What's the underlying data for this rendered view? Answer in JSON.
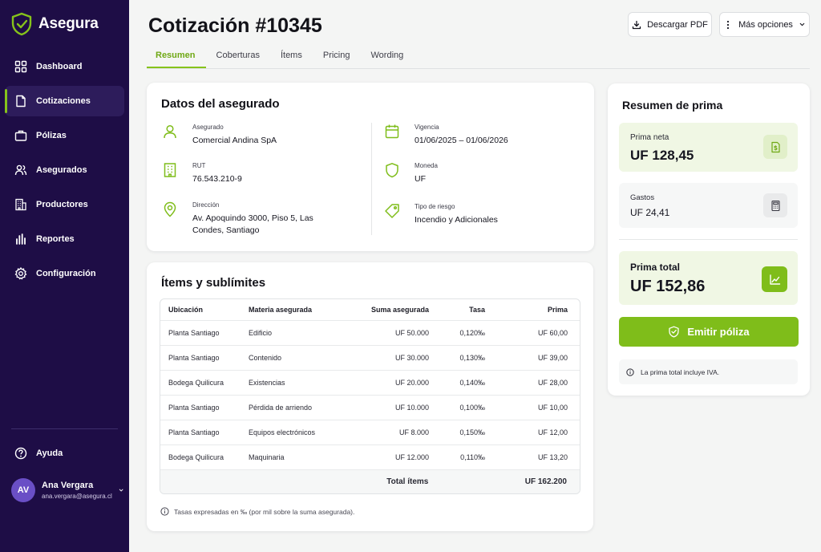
{
  "brand": {
    "name": "Asegura",
    "accent": "#86c31b",
    "sidebar_bg": "#1e0d46"
  },
  "sidebar": {
    "items": [
      {
        "label": "Dashboard",
        "icon": "grid-icon"
      },
      {
        "label": "Cotizaciones",
        "icon": "document-icon",
        "active": true
      },
      {
        "label": "Pólizas",
        "icon": "briefcase-icon"
      },
      {
        "label": "Asegurados",
        "icon": "users-icon"
      },
      {
        "label": "Productores",
        "icon": "building-icon"
      },
      {
        "label": "Reportes",
        "icon": "bar-chart-icon"
      },
      {
        "label": "Configuración",
        "icon": "gear-icon"
      }
    ],
    "help": "Ayuda",
    "user": {
      "initials": "AV",
      "name": "Ana Vergara",
      "email": "ana.vergara@asegura.cl"
    }
  },
  "header": {
    "title": "Cotización #10345",
    "download_label": "Descargar PDF",
    "more_label": "Más opciones",
    "tabs": [
      "Resumen",
      "Coberturas",
      "Ítems",
      "Pricing",
      "Wording"
    ]
  },
  "datos": {
    "title": "Datos del asegurado",
    "asegurado": {
      "label": "Asegurado",
      "value": "Comercial Andina SpA"
    },
    "rut": {
      "label": "RUT",
      "value": "76.543.210-9"
    },
    "direccion": {
      "label": "Dirección",
      "value_line1": "Av. Apoquindo 3000, Piso 5, Las",
      "value_line2": "Condes, Santiago"
    },
    "vigencia": {
      "label": "Vigencia",
      "value": "01/06/2025 – 01/06/2026"
    },
    "moneda": {
      "label": "Moneda",
      "value": "UF"
    },
    "riesgo": {
      "label": "Tipo de riesgo",
      "value": "Incendio y Adicionales"
    }
  },
  "items": {
    "title": "Ítems y sublímites",
    "columns": [
      "Ubicación",
      "Materia asegurada",
      "Suma asegurada",
      "Tasa",
      "Prima"
    ],
    "rows": [
      [
        "Planta Santiago",
        "Edificio",
        "UF 50.000",
        "0,120‰",
        "UF 60,00"
      ],
      [
        "Planta Santiago",
        "Contenido",
        "UF 30.000",
        "0,130‰",
        "UF 39,00"
      ],
      [
        "Bodega Quilicura",
        "Existencias",
        "UF 20.000",
        "0,140‰",
        "UF 28,00"
      ],
      [
        "Planta Santiago",
        "Pérdida de arriendo",
        "UF 10.000",
        "0,100‰",
        "UF 10,00"
      ],
      [
        "Planta Santiago",
        "Equipos electrónicos",
        "UF 8.000",
        "0,150‰",
        "UF 12,00"
      ],
      [
        "Bodega Quilicura",
        "Maquinaria",
        "UF 12.000",
        "0,110‰",
        "UF 13,20"
      ]
    ],
    "total_label": "Total ítems",
    "total_value": "UF 162.200",
    "note": "Tasas expresadas en ‰ (por mil sobre la suma asegurada)."
  },
  "resumen": {
    "title": "Resumen de prima",
    "prima_neta": {
      "label": "Prima neta",
      "value": "UF 128,45"
    },
    "gastos": {
      "label": "Gastos",
      "value": "UF 24,41"
    },
    "prima_total": {
      "label": "Prima total",
      "value": "UF 152,86"
    },
    "emit_label": "Emitir póliza",
    "iva_note": "La prima total incluye IVA."
  }
}
